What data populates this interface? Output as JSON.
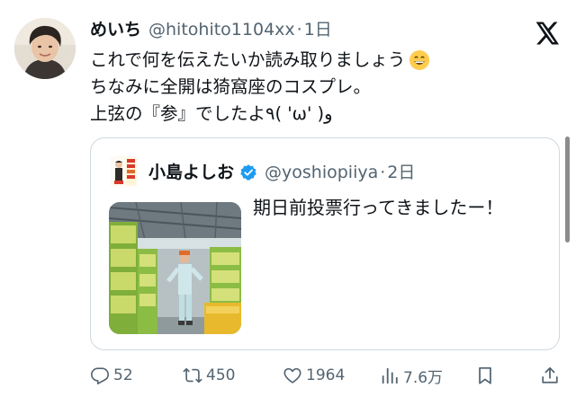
{
  "tweet": {
    "display_name": "めいち",
    "handle": "@hitohito1104xx",
    "separator": "·",
    "time": "1日",
    "lines": [
      "これで何を伝えたいか読み取りましょう",
      "ちなみに全開は猗窩座のコスプレ。",
      "上弦の『参』でしたよ٩( 'ω' )و"
    ],
    "emoji_name": "grinning-face-emoji"
  },
  "quote": {
    "display_name": "小島よしお",
    "handle": "@yoshiopiiya",
    "separator": "·",
    "time": "2日",
    "text": "期日前投票行ってきましたー！",
    "verified_color": "#1d9bf0",
    "media_description_icon": "photo"
  },
  "actions": {
    "reply_count": "52",
    "repost_count": "450",
    "like_count": "1964",
    "view_count": "7.6万"
  },
  "colors": {
    "text_primary": "#0f1419",
    "text_secondary": "#536471",
    "border": "#cfd9de",
    "verified": "#1d9bf0"
  },
  "icons": {
    "reply": "reply-icon",
    "repost": "repost-icon",
    "like": "like-icon",
    "views": "views-icon",
    "bookmark": "bookmark-icon",
    "share": "share-icon",
    "logo": "x-logo-icon"
  }
}
